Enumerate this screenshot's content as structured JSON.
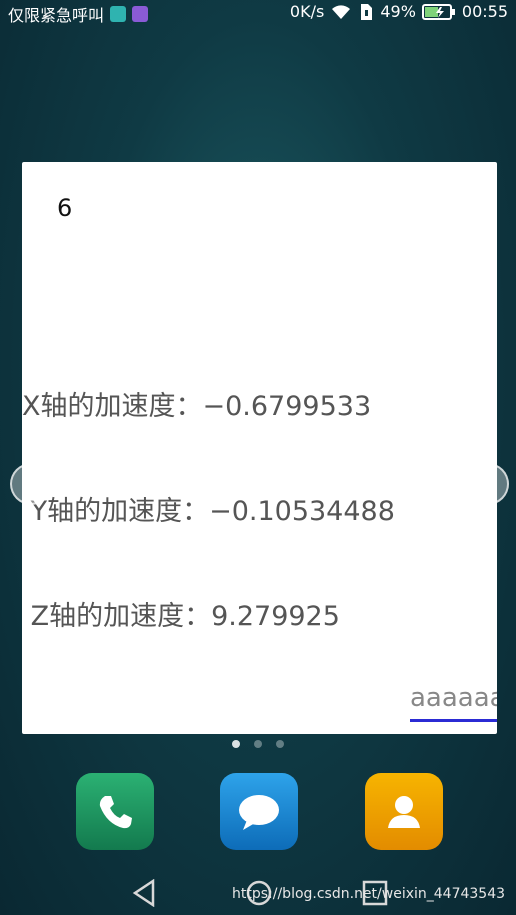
{
  "status_bar": {
    "left_text": "仅限紧急呼叫",
    "network_speed": "0K/s",
    "battery_percent": "49%",
    "time": "00:55",
    "icons": [
      "app-icon-teal",
      "app-icon-purple",
      "wifi-icon",
      "sim-icon",
      "battery-charging-icon"
    ]
  },
  "dialog": {
    "count": "6",
    "readings": {
      "x": "X轴的加速度：−0.6799533",
      "y": " Y轴的加速度：−0.10534488",
      "z": " Z轴的加速度：9.279925"
    },
    "input": {
      "value": "aaaaaa"
    }
  },
  "pager": {
    "pages": 3,
    "active_page": 0
  },
  "dock": {
    "apps": [
      {
        "name": "phone",
        "icon": "phone-icon",
        "color": "#1f9a63"
      },
      {
        "name": "messages",
        "icon": "message-icon",
        "color": "#1587d6"
      },
      {
        "name": "contacts",
        "icon": "contacts-icon",
        "color": "#f2a100"
      }
    ]
  },
  "nav_bar": {
    "icons": [
      "back-icon",
      "home-icon",
      "recents-icon"
    ]
  },
  "watermark": "https://blog.csdn.net/weixin_44743543"
}
